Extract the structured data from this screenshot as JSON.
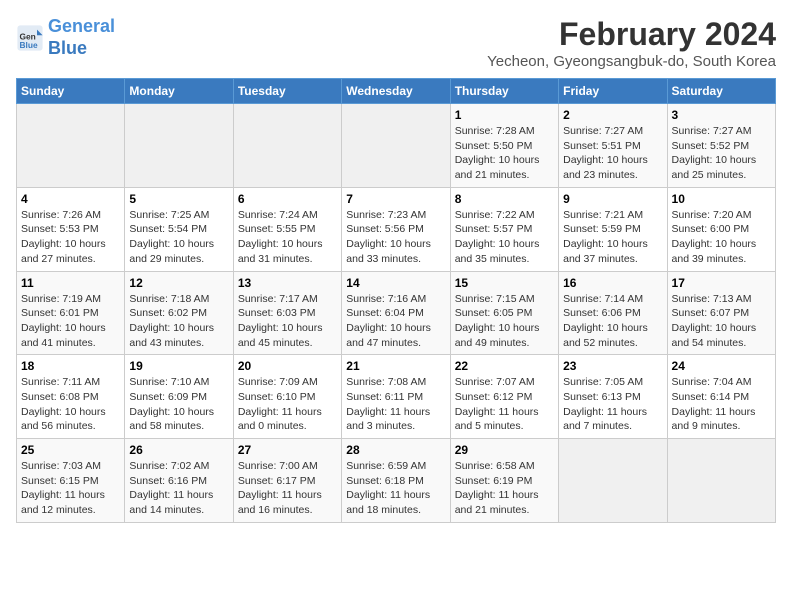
{
  "logo": {
    "line1": "General",
    "line2": "Blue"
  },
  "title": "February 2024",
  "subtitle": "Yecheon, Gyeongsangbuk-do, South Korea",
  "weekdays": [
    "Sunday",
    "Monday",
    "Tuesday",
    "Wednesday",
    "Thursday",
    "Friday",
    "Saturday"
  ],
  "weeks": [
    [
      {
        "day": "",
        "info": ""
      },
      {
        "day": "",
        "info": ""
      },
      {
        "day": "",
        "info": ""
      },
      {
        "day": "",
        "info": ""
      },
      {
        "day": "1",
        "info": "Sunrise: 7:28 AM\nSunset: 5:50 PM\nDaylight: 10 hours and 21 minutes."
      },
      {
        "day": "2",
        "info": "Sunrise: 7:27 AM\nSunset: 5:51 PM\nDaylight: 10 hours and 23 minutes."
      },
      {
        "day": "3",
        "info": "Sunrise: 7:27 AM\nSunset: 5:52 PM\nDaylight: 10 hours and 25 minutes."
      }
    ],
    [
      {
        "day": "4",
        "info": "Sunrise: 7:26 AM\nSunset: 5:53 PM\nDaylight: 10 hours and 27 minutes."
      },
      {
        "day": "5",
        "info": "Sunrise: 7:25 AM\nSunset: 5:54 PM\nDaylight: 10 hours and 29 minutes."
      },
      {
        "day": "6",
        "info": "Sunrise: 7:24 AM\nSunset: 5:55 PM\nDaylight: 10 hours and 31 minutes."
      },
      {
        "day": "7",
        "info": "Sunrise: 7:23 AM\nSunset: 5:56 PM\nDaylight: 10 hours and 33 minutes."
      },
      {
        "day": "8",
        "info": "Sunrise: 7:22 AM\nSunset: 5:57 PM\nDaylight: 10 hours and 35 minutes."
      },
      {
        "day": "9",
        "info": "Sunrise: 7:21 AM\nSunset: 5:59 PM\nDaylight: 10 hours and 37 minutes."
      },
      {
        "day": "10",
        "info": "Sunrise: 7:20 AM\nSunset: 6:00 PM\nDaylight: 10 hours and 39 minutes."
      }
    ],
    [
      {
        "day": "11",
        "info": "Sunrise: 7:19 AM\nSunset: 6:01 PM\nDaylight: 10 hours and 41 minutes."
      },
      {
        "day": "12",
        "info": "Sunrise: 7:18 AM\nSunset: 6:02 PM\nDaylight: 10 hours and 43 minutes."
      },
      {
        "day": "13",
        "info": "Sunrise: 7:17 AM\nSunset: 6:03 PM\nDaylight: 10 hours and 45 minutes."
      },
      {
        "day": "14",
        "info": "Sunrise: 7:16 AM\nSunset: 6:04 PM\nDaylight: 10 hours and 47 minutes."
      },
      {
        "day": "15",
        "info": "Sunrise: 7:15 AM\nSunset: 6:05 PM\nDaylight: 10 hours and 49 minutes."
      },
      {
        "day": "16",
        "info": "Sunrise: 7:14 AM\nSunset: 6:06 PM\nDaylight: 10 hours and 52 minutes."
      },
      {
        "day": "17",
        "info": "Sunrise: 7:13 AM\nSunset: 6:07 PM\nDaylight: 10 hours and 54 minutes."
      }
    ],
    [
      {
        "day": "18",
        "info": "Sunrise: 7:11 AM\nSunset: 6:08 PM\nDaylight: 10 hours and 56 minutes."
      },
      {
        "day": "19",
        "info": "Sunrise: 7:10 AM\nSunset: 6:09 PM\nDaylight: 10 hours and 58 minutes."
      },
      {
        "day": "20",
        "info": "Sunrise: 7:09 AM\nSunset: 6:10 PM\nDaylight: 11 hours and 0 minutes."
      },
      {
        "day": "21",
        "info": "Sunrise: 7:08 AM\nSunset: 6:11 PM\nDaylight: 11 hours and 3 minutes."
      },
      {
        "day": "22",
        "info": "Sunrise: 7:07 AM\nSunset: 6:12 PM\nDaylight: 11 hours and 5 minutes."
      },
      {
        "day": "23",
        "info": "Sunrise: 7:05 AM\nSunset: 6:13 PM\nDaylight: 11 hours and 7 minutes."
      },
      {
        "day": "24",
        "info": "Sunrise: 7:04 AM\nSunset: 6:14 PM\nDaylight: 11 hours and 9 minutes."
      }
    ],
    [
      {
        "day": "25",
        "info": "Sunrise: 7:03 AM\nSunset: 6:15 PM\nDaylight: 11 hours and 12 minutes."
      },
      {
        "day": "26",
        "info": "Sunrise: 7:02 AM\nSunset: 6:16 PM\nDaylight: 11 hours and 14 minutes."
      },
      {
        "day": "27",
        "info": "Sunrise: 7:00 AM\nSunset: 6:17 PM\nDaylight: 11 hours and 16 minutes."
      },
      {
        "day": "28",
        "info": "Sunrise: 6:59 AM\nSunset: 6:18 PM\nDaylight: 11 hours and 18 minutes."
      },
      {
        "day": "29",
        "info": "Sunrise: 6:58 AM\nSunset: 6:19 PM\nDaylight: 11 hours and 21 minutes."
      },
      {
        "day": "",
        "info": ""
      },
      {
        "day": "",
        "info": ""
      }
    ]
  ]
}
